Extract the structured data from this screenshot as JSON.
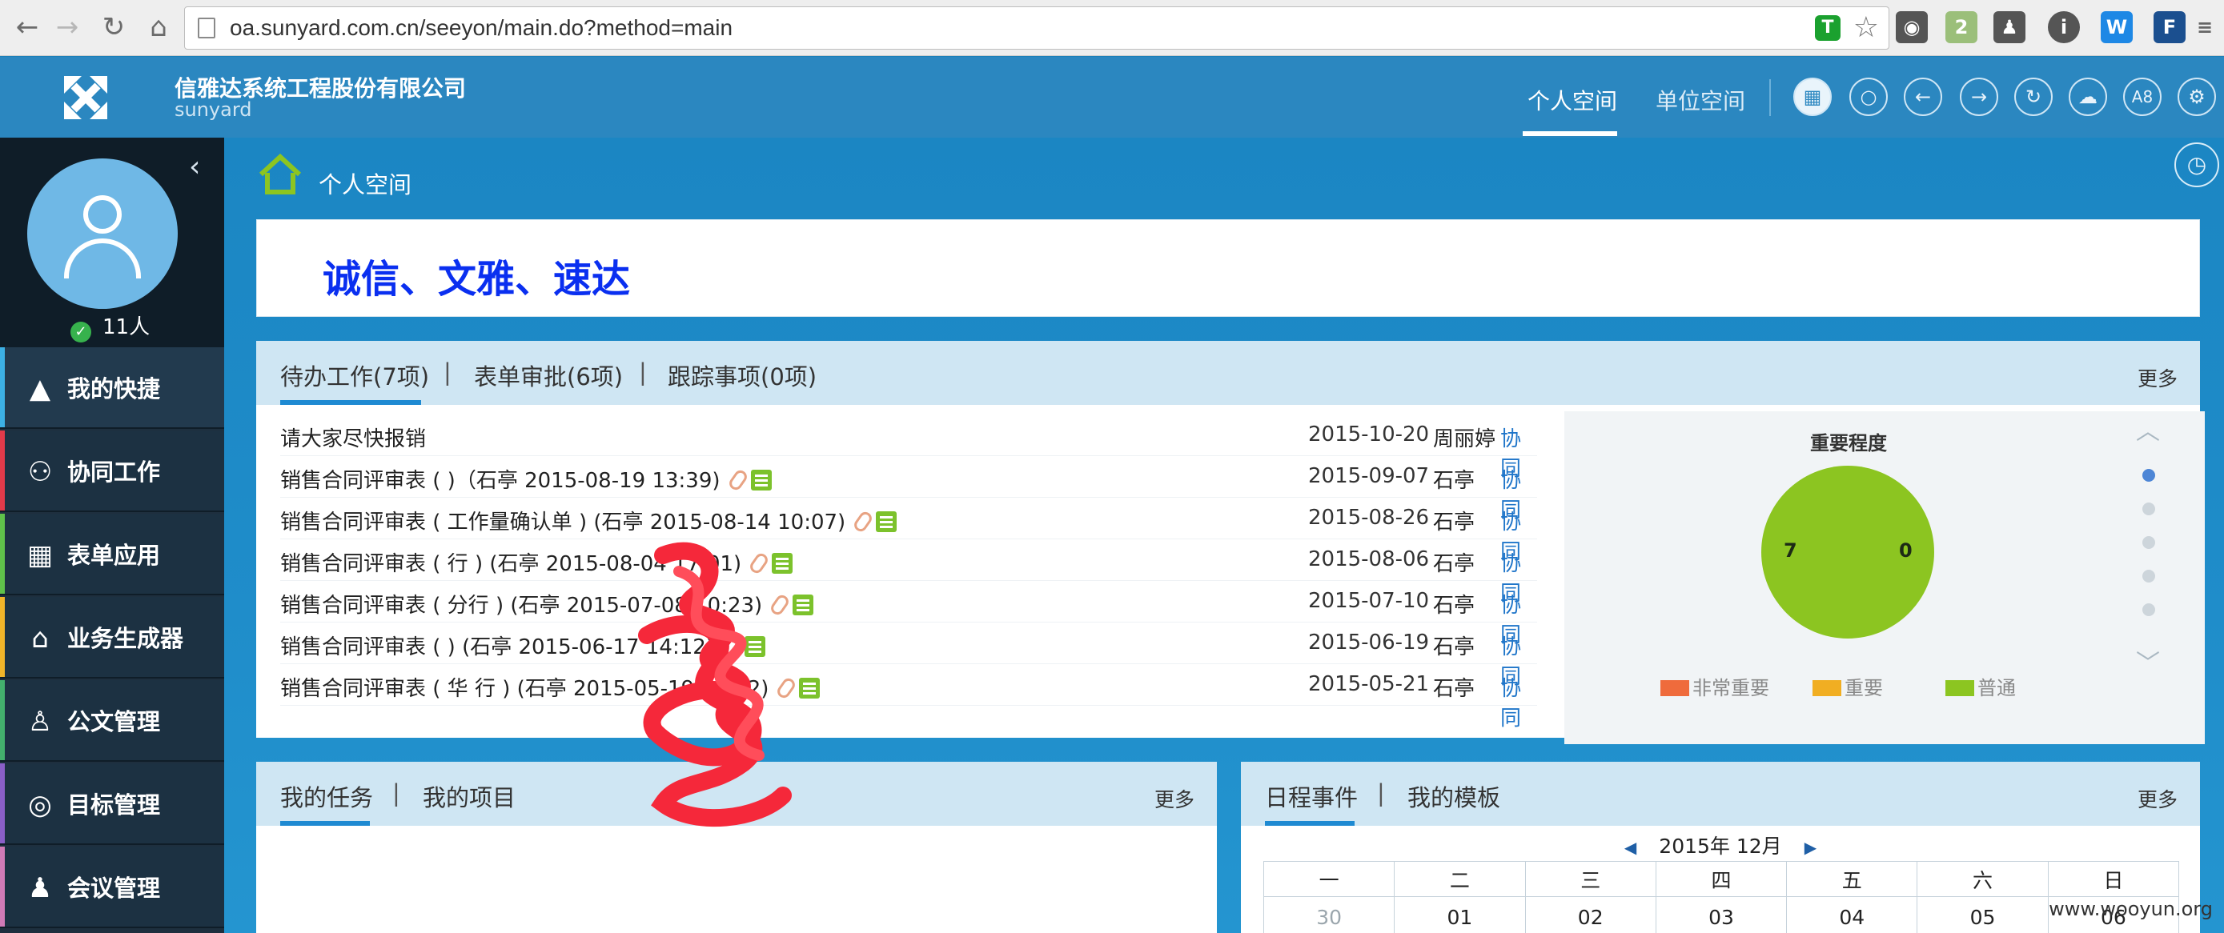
{
  "browser": {
    "url": "oa.sunyard.com.cn/seeyon/main.do?method=main",
    "extensions": [
      {
        "name": "shield-ext",
        "text": "T",
        "color": "#1ba12f"
      },
      {
        "name": "spy-ext",
        "text": "",
        "color": "#555555"
      },
      {
        "name": "badge-ext",
        "text": "2",
        "color": "#9bbf7a"
      },
      {
        "name": "person-ext",
        "text": "",
        "color": "#555555"
      },
      {
        "name": "info-ext",
        "text": "i",
        "color": "#555555"
      },
      {
        "name": "w-ext",
        "text": "W",
        "color": "#1e88e5"
      },
      {
        "name": "f-ext",
        "text": "F",
        "color": "#1b4f8f"
      },
      {
        "name": "a8-ext",
        "text": "A8",
        "color": "#777777"
      },
      {
        "name": "menu-ext",
        "text": "≡",
        "color": "#666666"
      }
    ]
  },
  "header": {
    "company": "信雅达系统工程股份有限公司",
    "company_sub": "sunyard",
    "tabs": [
      {
        "label": "个人空间",
        "active": true
      },
      {
        "label": "单位空间",
        "active": false
      }
    ],
    "icons": [
      "grid-icon",
      "search-icon",
      "back-icon",
      "forward-icon",
      "refresh-icon",
      "cloud-icon",
      "a8-icon",
      "gear-icon"
    ],
    "a8_label": "A8"
  },
  "sidebar": {
    "online_count": "11人",
    "items": [
      {
        "label": "我的快捷",
        "icon": "▲",
        "bar": "#3cb0e4",
        "active": true
      },
      {
        "label": "协同工作",
        "icon": "⚇",
        "bar": "#e23a4a",
        "active": false
      },
      {
        "label": "表单应用",
        "icon": "▦",
        "bar": "#5fc14a",
        "active": false
      },
      {
        "label": "业务生成器",
        "icon": "⌂",
        "bar": "#f0b429",
        "active": false
      },
      {
        "label": "公文管理",
        "icon": "♙",
        "bar": "#43b06d",
        "active": false
      },
      {
        "label": "目标管理",
        "icon": "◎",
        "bar": "#8a5fc8",
        "active": false
      },
      {
        "label": "会议管理",
        "icon": "♟",
        "bar": "#d07ab6",
        "active": false
      }
    ]
  },
  "main": {
    "breadcrumb": "个人空间",
    "slogan": "诚信、文雅、速达",
    "todo": {
      "tabs": [
        "待办工作(7项)",
        "表单审批(6项)",
        "跟踪事项(0项)"
      ],
      "separator": "|",
      "more": "更多",
      "rows": [
        {
          "title": "请大家尽快报销",
          "date": "2015-10-20",
          "person": "周丽婷",
          "type": "协同",
          "attach": false
        },
        {
          "title": "销售合同评审表 ( )（石亭 2015-08-19 13:39)",
          "date": "2015-09-07",
          "person": "石亭",
          "type": "协同",
          "attach": true
        },
        {
          "title": "销售合同评审表 ( 工作量确认单 ) (石亭 2015-08-14 10:07)",
          "date": "2015-08-26",
          "person": "石亭",
          "type": "协同",
          "attach": true
        },
        {
          "title": "销售合同评审表 ( 行 ) (石亭 2015-08-04 17:01)",
          "date": "2015-08-06",
          "person": "石亭",
          "type": "协同",
          "attach": true
        },
        {
          "title": "销售合同评审表 ( 分行 ) (石亭 2015-07-08 10:23)",
          "date": "2015-07-10",
          "person": "石亭",
          "type": "协同",
          "attach": true
        },
        {
          "title": "销售合同评审表 ( ) (石亭 2015-06-17 14:12)",
          "date": "2015-06-19",
          "person": "石亭",
          "type": "协同",
          "attach": true
        },
        {
          "title": "销售合同评审表 ( 华 行 ) (石亭 2015-05-19 09:42)",
          "date": "2015-05-21",
          "person": "石亭",
          "type": "协同",
          "attach": true
        }
      ]
    },
    "importance": {
      "title": "重要程度",
      "left_value": "7",
      "right_value": "0",
      "pie_color": "#8cc521",
      "legend": [
        {
          "label": "非常重要",
          "color": "#ef6b3c"
        },
        {
          "label": "重要",
          "color": "#f1ae22"
        },
        {
          "label": "普通",
          "color": "#8cc521"
        }
      ]
    },
    "tasks": {
      "tabs": [
        "我的任务",
        "我的项目"
      ],
      "separator": "|",
      "more": "更多"
    },
    "calendar": {
      "tabs": [
        "日程事件",
        "我的模板"
      ],
      "separator": "|",
      "more": "更多",
      "month": "2015年 12月",
      "weekdays": [
        "一",
        "二",
        "三",
        "四",
        "五",
        "六",
        "日"
      ],
      "days": [
        "30",
        "01",
        "02",
        "03",
        "04",
        "05",
        "06"
      ]
    },
    "watermark": "www.wooyun.org"
  }
}
